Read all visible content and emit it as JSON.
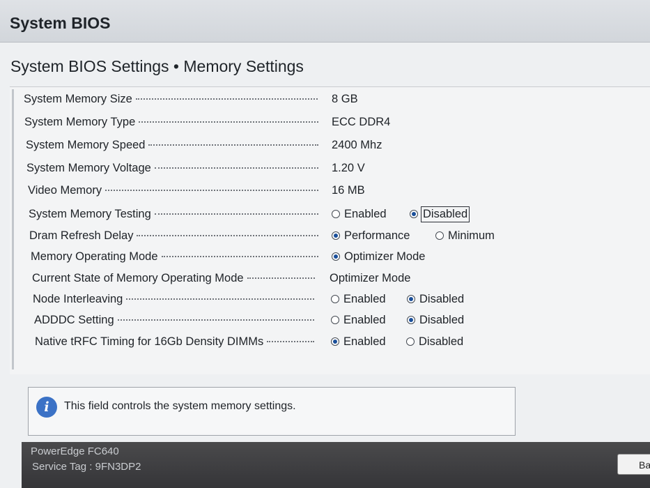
{
  "app_title": "System BIOS",
  "page_title": "System BIOS Settings • Memory Settings",
  "settings": [
    {
      "label": "System Memory Size",
      "value": "8 GB"
    },
    {
      "label": "System Memory Type",
      "value": "ECC DDR4"
    },
    {
      "label": "System Memory Speed",
      "value": "2400 Mhz"
    },
    {
      "label": "System Memory Voltage",
      "value": "1.20 V"
    },
    {
      "label": "Video Memory",
      "value": "16 MB"
    },
    {
      "label": "System Memory Testing",
      "options": [
        {
          "label": "Enabled",
          "selected": false
        },
        {
          "label": "Disabled",
          "selected": true
        }
      ]
    },
    {
      "label": "Dram Refresh Delay",
      "options": [
        {
          "label": "Performance",
          "selected": true
        },
        {
          "label": "Minimum",
          "selected": false
        }
      ]
    },
    {
      "label": "Memory Operating Mode",
      "options": [
        {
          "label": "Optimizer Mode",
          "selected": true
        }
      ]
    },
    {
      "label": "Current State of Memory Operating Mode",
      "value": "Optimizer Mode"
    },
    {
      "label": "Node Interleaving",
      "options": [
        {
          "label": "Enabled",
          "selected": false
        },
        {
          "label": "Disabled",
          "selected": true
        }
      ]
    },
    {
      "label": "ADDDC Setting",
      "options": [
        {
          "label": "Enabled",
          "selected": false
        },
        {
          "label": "Disabled",
          "selected": true
        }
      ]
    },
    {
      "label": "Native tRFC Timing for 16Gb Density DIMMs",
      "options": [
        {
          "label": "Enabled",
          "selected": true
        },
        {
          "label": "Disabled",
          "selected": false
        }
      ]
    }
  ],
  "help_text": "This field controls the system memory settings.",
  "footer": {
    "model": "PowerEdge FC640",
    "service_tag": "Service Tag : 9FN3DP2",
    "back_label": "Ba"
  },
  "colors": {
    "radio_selected": "#1a4f9a",
    "info_icon": "#3b72c6",
    "footer_bg": "#3f3f42"
  },
  "icons": {
    "info": "info-icon"
  }
}
